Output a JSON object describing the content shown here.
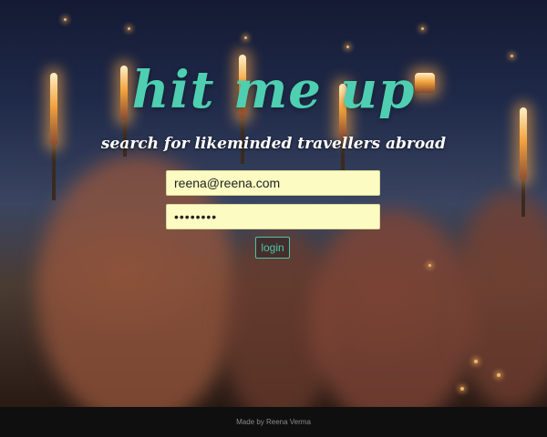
{
  "header": {
    "title": "hit me up",
    "subtitle": "search for likeminded travellers abroad"
  },
  "login_form": {
    "email_value": "reena@reena.com",
    "password_value": "••••••••",
    "login_label": "login"
  },
  "footer": {
    "credit": "Made by Reena Verma"
  },
  "colors": {
    "accent": "#4ecfb1",
    "input_background": "#fbfbc2",
    "footer_background": "#0f0f10"
  }
}
